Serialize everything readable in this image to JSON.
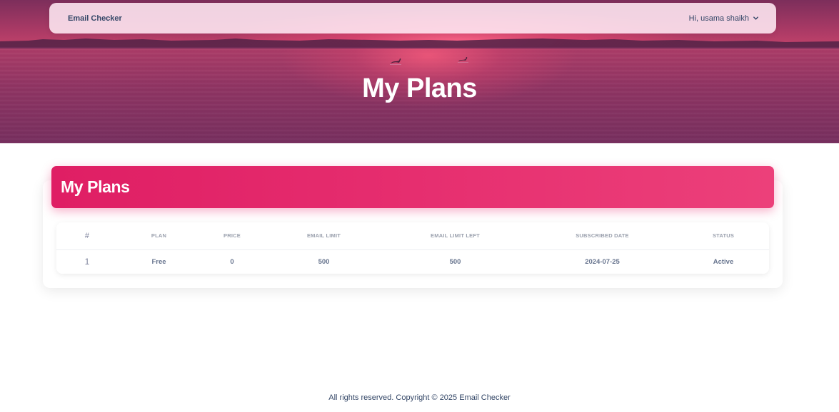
{
  "navbar": {
    "brand": "Email Checker",
    "greeting": "Hi, usama shaikh"
  },
  "hero": {
    "title": "My Plans"
  },
  "card": {
    "title": "My Plans"
  },
  "table": {
    "headers": [
      "#",
      "PLAN",
      "PRICE",
      "EMAIL LIMIT",
      "EMAIL LIMIT LEFT",
      "SUBSCRIBED DATE",
      "STATUS"
    ],
    "rows": [
      [
        "1",
        "Free",
        "0",
        "500",
        "500",
        "2024-07-25",
        "Active"
      ]
    ]
  },
  "footer": {
    "text": "All rights reserved. Copyright © 2025 Email Checker"
  },
  "colors": {
    "accent": "#e91e63",
    "text": "#344767"
  }
}
